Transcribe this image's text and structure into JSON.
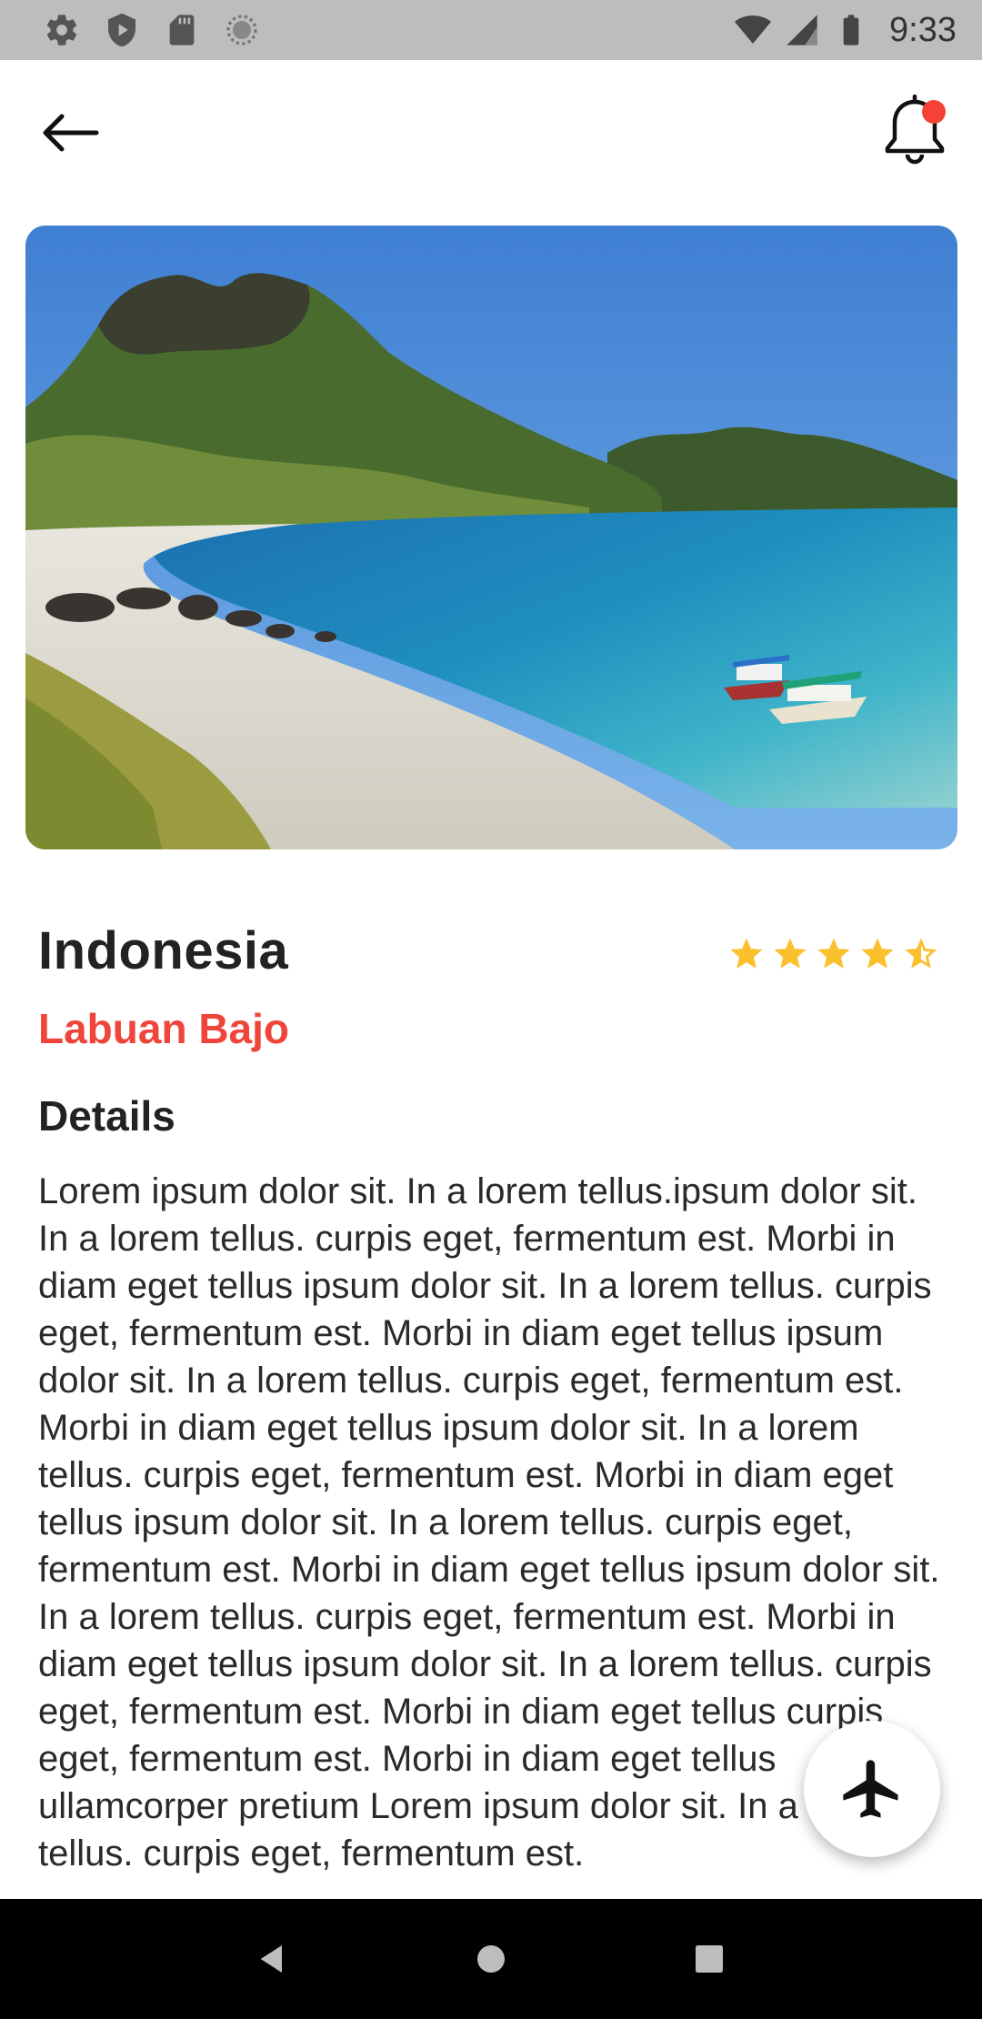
{
  "status_bar": {
    "time": "9:33",
    "left_icons": [
      "settings-icon",
      "shield-play-icon",
      "sd-card-icon",
      "sync-circle-icon"
    ],
    "right_icons": [
      "wifi-icon",
      "signal-icon",
      "battery-icon"
    ]
  },
  "top_bar": {
    "back_icon": "arrow-left-icon",
    "notification_icon": "bell-icon",
    "has_notification_dot": true
  },
  "hero": {
    "image": "tropical-beach-bay-with-mountains-and-boats"
  },
  "place": {
    "country": "Indonesia",
    "city": "Labuan Bajo",
    "rating": 4.5,
    "rating_max": 5
  },
  "details": {
    "heading": "Details",
    "body": "Lorem ipsum dolor sit. In a lorem tellus.ipsum dolor sit. In a lorem tellus. curpis eget, fermentum est. Morbi in diam eget tellus  ipsum dolor sit. In a lorem tellus. curpis eget, fermentum est. Morbi in diam eget tellus ipsum dolor sit. In a lorem tellus. curpis eget, fermentum est. Morbi in diam eget tellus ipsum dolor sit. In a lorem tellus. curpis eget, fermentum est. Morbi in diam eget tellus ipsum dolor sit. In a lorem tellus. curpis eget, fermentum est. Morbi in diam eget tellus ipsum dolor sit. In a lorem tellus. curpis eget, fermentum est. Morbi in diam eget tellus ipsum dolor sit. In a lorem tellus. curpis eget, fermentum est. Morbi in diam eget tellus curpis eget, fermentum est. Morbi in diam eget tellus ullamcorper pretium Lorem ipsum dolor sit. In a lorem tellus. curpis eget, fermentum est."
  },
  "fab": {
    "icon": "airplane-icon"
  },
  "nav_bar": {
    "icons": [
      "nav-back-icon",
      "nav-home-icon",
      "nav-recents-icon"
    ]
  },
  "colors": {
    "accent": "#f0453a",
    "star": "#fbc02d",
    "notification_dot": "#f44336",
    "status_bar": "#bdbdbd"
  }
}
